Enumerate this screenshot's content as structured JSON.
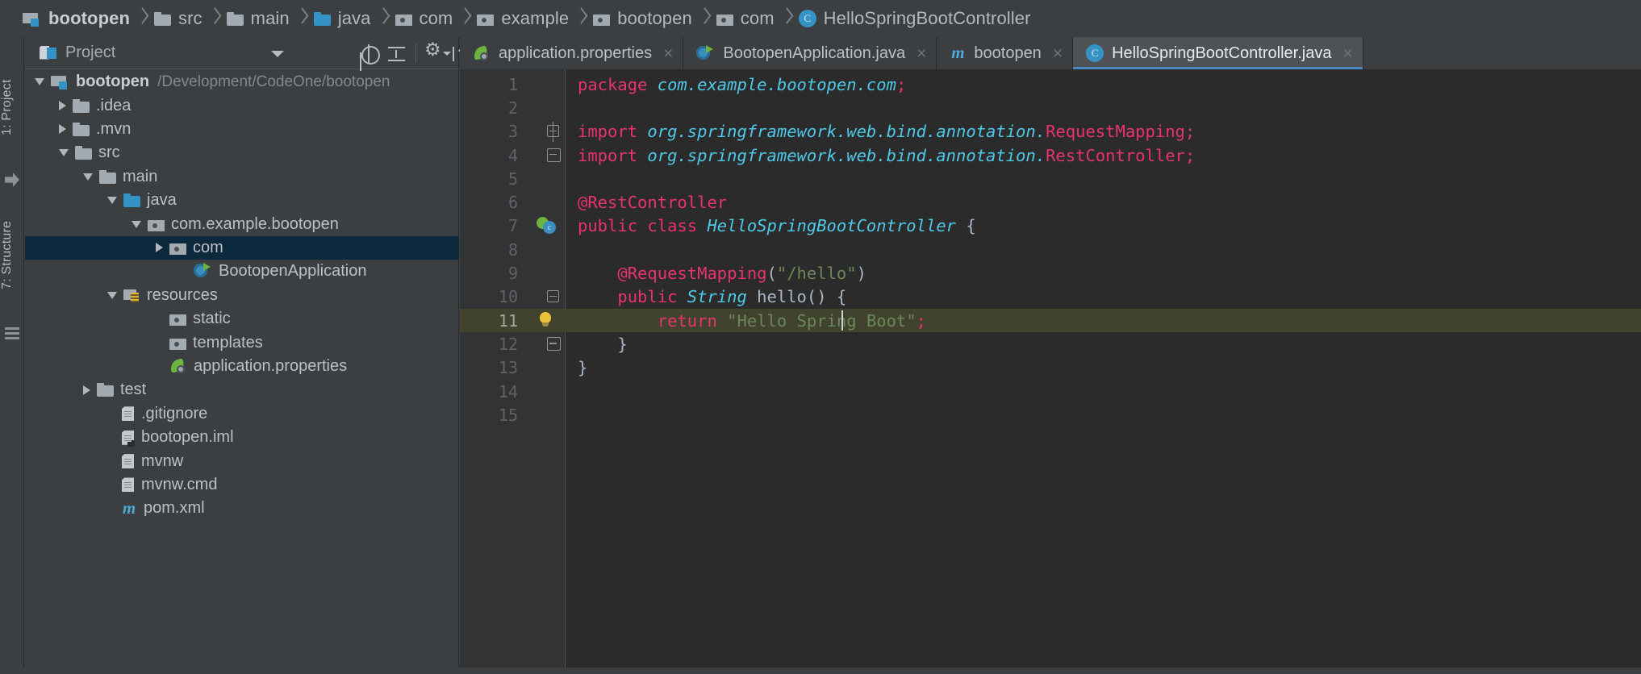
{
  "breadcrumb": {
    "items": [
      {
        "label": "bootopen",
        "icon": "module-icon",
        "root": true
      },
      {
        "label": "src",
        "icon": "folder-icon"
      },
      {
        "label": "main",
        "icon": "folder-icon"
      },
      {
        "label": "java",
        "icon": "folder-blue-icon"
      },
      {
        "label": "com",
        "icon": "package-icon"
      },
      {
        "label": "example",
        "icon": "package-icon"
      },
      {
        "label": "bootopen",
        "icon": "package-icon"
      },
      {
        "label": "com",
        "icon": "package-icon"
      },
      {
        "label": "HelloSpringBootController",
        "icon": "class-icon"
      }
    ]
  },
  "left_strip": {
    "project_label": "1: Project",
    "structure_label": "7: Structure"
  },
  "project_panel": {
    "title": "Project",
    "title_icon": "project-view-icon",
    "toolbar": {
      "locate_label": "locate-in-tree-icon",
      "collapse_label": "collapse-all-icon",
      "settings_label": "gear-icon",
      "hide_label": "hide-panel-icon",
      "dropdown_label": "chevron-down-icon"
    },
    "tree": [
      {
        "label": "bootopen",
        "path": "/Development/CodeOne/bootopen",
        "twist": "open",
        "icon": "module-icon",
        "indent": 0,
        "bold": true,
        "selected": false
      },
      {
        "label": ".idea",
        "path": "",
        "twist": "closed",
        "icon": "folder-icon",
        "indent": 1,
        "bold": false,
        "selected": false
      },
      {
        "label": ".mvn",
        "path": "",
        "twist": "closed",
        "icon": "folder-icon",
        "indent": 1,
        "bold": false,
        "selected": false
      },
      {
        "label": "src",
        "path": "",
        "twist": "open",
        "icon": "folder-icon",
        "indent": 1,
        "bold": false,
        "selected": false
      },
      {
        "label": "main",
        "path": "",
        "twist": "open",
        "icon": "folder-icon",
        "indent": 2,
        "bold": false,
        "selected": false
      },
      {
        "label": "java",
        "path": "",
        "twist": "open",
        "icon": "folder-blue-icon",
        "indent": 3,
        "bold": false,
        "selected": false
      },
      {
        "label": "com.example.bootopen",
        "path": "",
        "twist": "open",
        "icon": "package-icon",
        "indent": 4,
        "bold": false,
        "selected": false
      },
      {
        "label": "com",
        "path": "",
        "twist": "closed",
        "icon": "package-icon",
        "indent": 5,
        "bold": false,
        "selected": true
      },
      {
        "label": "BootopenApplication",
        "path": "",
        "twist": "none",
        "icon": "spring-app-icon",
        "indent": 6,
        "bold": false,
        "selected": false
      },
      {
        "label": "resources",
        "path": "",
        "twist": "open",
        "icon": "resources-icon",
        "indent": 3,
        "bold": false,
        "selected": false
      },
      {
        "label": "static",
        "path": "",
        "twist": "none",
        "icon": "package-icon",
        "indent": 5,
        "bold": false,
        "selected": false
      },
      {
        "label": "templates",
        "path": "",
        "twist": "none",
        "icon": "package-icon",
        "indent": 5,
        "bold": false,
        "selected": false
      },
      {
        "label": "application.properties",
        "path": "",
        "twist": "none",
        "icon": "spring-leaf-icon",
        "indent": 5,
        "bold": false,
        "selected": false
      },
      {
        "label": "test",
        "path": "",
        "twist": "closed",
        "icon": "folder-icon",
        "indent": 2,
        "bold": false,
        "selected": false
      },
      {
        "label": ".gitignore",
        "path": "",
        "twist": "none",
        "icon": "file-icon",
        "indent": 3,
        "bold": false,
        "selected": false
      },
      {
        "label": "bootopen.iml",
        "path": "",
        "twist": "none",
        "icon": "iml-file-icon",
        "indent": 3,
        "bold": false,
        "selected": false
      },
      {
        "label": "mvnw",
        "path": "",
        "twist": "none",
        "icon": "file-icon",
        "indent": 3,
        "bold": false,
        "selected": false
      },
      {
        "label": "mvnw.cmd",
        "path": "",
        "twist": "none",
        "icon": "file-icon",
        "indent": 3,
        "bold": false,
        "selected": false
      },
      {
        "label": "pom.xml",
        "path": "",
        "twist": "none",
        "icon": "maven-icon",
        "indent": 3,
        "bold": false,
        "selected": false
      }
    ]
  },
  "editor": {
    "tabs": [
      {
        "label": "application.properties",
        "icon": "spring-leaf-icon",
        "active": false,
        "close": "×"
      },
      {
        "label": "BootopenApplication.java",
        "icon": "spring-app-icon",
        "active": false,
        "close": "×"
      },
      {
        "label": "bootopen",
        "icon": "maven-icon",
        "active": false,
        "close": "×"
      },
      {
        "label": "HelloSpringBootController.java",
        "icon": "class-icon",
        "active": true,
        "close": "×"
      }
    ],
    "line_numbers": [
      "1",
      "2",
      "3",
      "4",
      "5",
      "6",
      "7",
      "8",
      "9",
      "10",
      "11",
      "12",
      "13",
      "14",
      "15"
    ],
    "highlighted_line": 11,
    "caret_line": 11,
    "gutter_icons": [
      {
        "line": 7,
        "icon": "spring-bean-icon"
      },
      {
        "line": 11,
        "icon": "lightbulb-icon"
      }
    ],
    "code": [
      {
        "n": 1,
        "tokens": [
          {
            "t": "package ",
            "c": "kwp"
          },
          {
            "t": "com.example.bootopen.com",
            "c": "ident"
          },
          {
            "t": ";",
            "c": "semi"
          }
        ]
      },
      {
        "n": 2,
        "tokens": []
      },
      {
        "n": 3,
        "tokens": [
          {
            "t": "import ",
            "c": "kwp"
          },
          {
            "t": "org.springframework.web.bind.annotation.",
            "c": "ident"
          },
          {
            "t": "RequestMapping",
            "c": "anno"
          },
          {
            "t": ";",
            "c": "semi"
          }
        ]
      },
      {
        "n": 4,
        "tokens": [
          {
            "t": "import ",
            "c": "kwp"
          },
          {
            "t": "org.springframework.web.bind.annotation.",
            "c": "ident"
          },
          {
            "t": "RestController",
            "c": "anno"
          },
          {
            "t": ";",
            "c": "semi"
          }
        ]
      },
      {
        "n": 5,
        "tokens": []
      },
      {
        "n": 6,
        "tokens": [
          {
            "t": "@RestController",
            "c": "anno"
          }
        ]
      },
      {
        "n": 7,
        "tokens": [
          {
            "t": "public class ",
            "c": "kwp"
          },
          {
            "t": "HelloSpringBootController",
            "c": "ident"
          },
          {
            "t": " {",
            "c": "plain"
          }
        ]
      },
      {
        "n": 8,
        "tokens": []
      },
      {
        "n": 9,
        "tokens": [
          {
            "t": "    ",
            "c": "plain"
          },
          {
            "t": "@RequestMapping",
            "c": "anno"
          },
          {
            "t": "(",
            "c": "plain"
          },
          {
            "t": "\"/hello\"",
            "c": "str"
          },
          {
            "t": ")",
            "c": "plain"
          }
        ]
      },
      {
        "n": 10,
        "tokens": [
          {
            "t": "    ",
            "c": "plain"
          },
          {
            "t": "public ",
            "c": "kwp"
          },
          {
            "t": "String",
            "c": "ident"
          },
          {
            "t": " hello",
            "c": "plain"
          },
          {
            "t": "() {",
            "c": "plain"
          }
        ]
      },
      {
        "n": 11,
        "tokens": [
          {
            "t": "        ",
            "c": "plain"
          },
          {
            "t": "return ",
            "c": "kwp"
          },
          {
            "t": "\"Hello Spring Boot\"",
            "c": "str"
          },
          {
            "t": ";",
            "c": "semi"
          }
        ]
      },
      {
        "n": 12,
        "tokens": [
          {
            "t": "    }",
            "c": "plain"
          }
        ]
      },
      {
        "n": 13,
        "tokens": [
          {
            "t": "}",
            "c": "plain"
          }
        ]
      },
      {
        "n": 14,
        "tokens": []
      },
      {
        "n": 15,
        "tokens": []
      }
    ]
  },
  "colors": {
    "panel_bg": "#3c3f41",
    "editor_bg": "#2b2b2b",
    "gutter_bg": "#313335",
    "selection_blue": "#0d293e",
    "highlight_line": "#41432f",
    "accent_blue": "#3592c4",
    "keyword_pink": "#e8336d",
    "identifier_cyan": "#4ec9e8",
    "string_green": "#6a8759",
    "text_grey": "#bcc0c4"
  }
}
